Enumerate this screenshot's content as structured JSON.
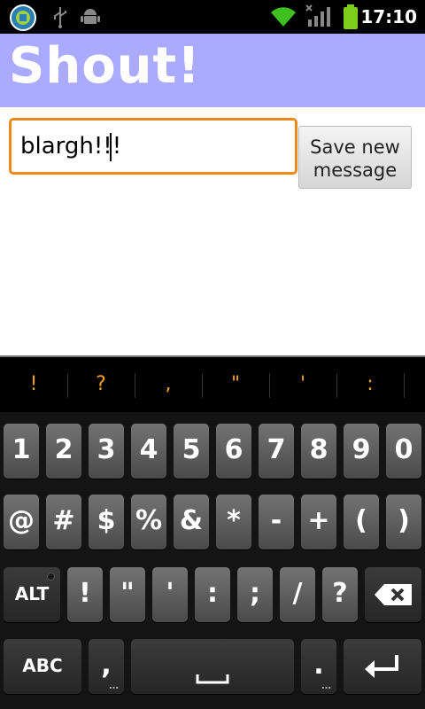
{
  "status_bar": {
    "time": "17:10",
    "icons": [
      "app-notification-icon",
      "usb-icon",
      "android-debug-icon",
      "wifi-icon",
      "no-signal-icon",
      "signal-bars-icon",
      "battery-icon"
    ]
  },
  "app": {
    "title": "Shout!",
    "title_bar_color": "#aaaaff"
  },
  "form": {
    "message_value": "blargh!!!",
    "save_button_line1": "Save new",
    "save_button_line2": "message",
    "input_focus_color": "#f0891c"
  },
  "keyboard": {
    "suggestions": [
      "!",
      "?",
      ",",
      "\"",
      "'",
      ":"
    ],
    "row1": [
      "1",
      "2",
      "3",
      "4",
      "5",
      "6",
      "7",
      "8",
      "9",
      "0"
    ],
    "row2": [
      "@",
      "#",
      "$",
      "%",
      "&",
      "*",
      "-",
      "+",
      "(",
      ")"
    ],
    "row3": [
      "ALT",
      "!",
      "\"",
      "'",
      ":",
      ";",
      "/",
      "?"
    ],
    "row4": {
      "abc": "ABC",
      "comma": ",",
      "period": "."
    },
    "sub_hint": "…",
    "suggestion_color": "#f0a020"
  }
}
